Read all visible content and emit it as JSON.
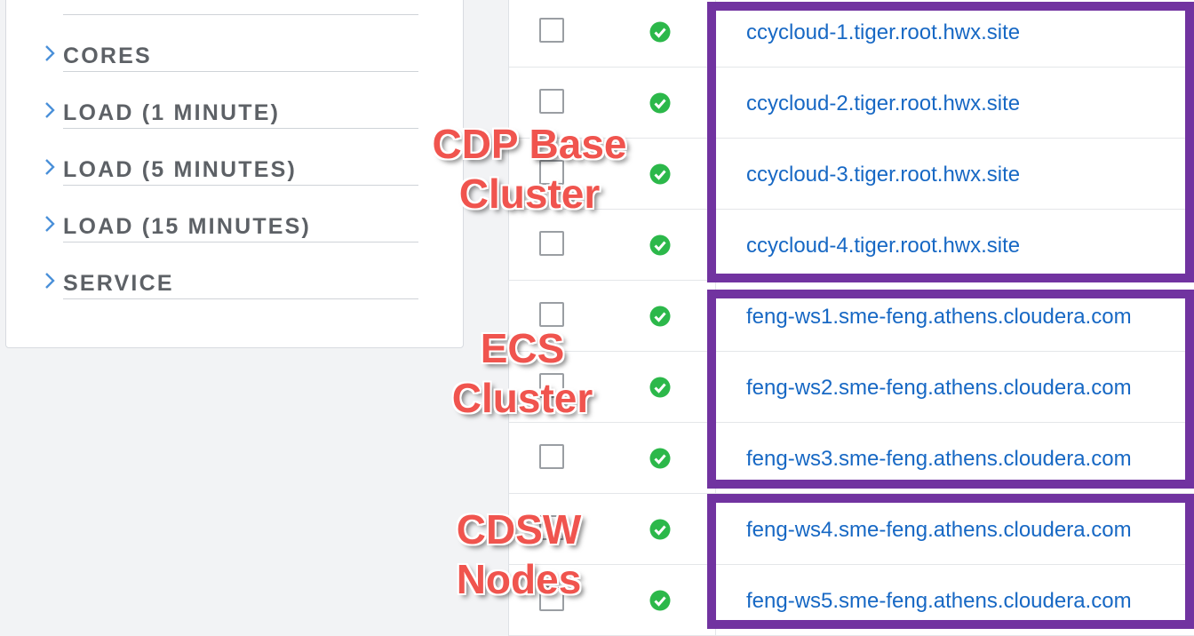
{
  "filters": [
    {
      "label": "CORES",
      "icon": "chevron-right-icon"
    },
    {
      "label": "LOAD (1 MINUTE)",
      "icon": "chevron-right-icon"
    },
    {
      "label": "LOAD (5 MINUTES)",
      "icon": "chevron-right-icon"
    },
    {
      "label": "LOAD (15 MINUTES)",
      "icon": "chevron-right-icon"
    },
    {
      "label": "SERVICE",
      "icon": "chevron-right-icon"
    }
  ],
  "hosts": [
    {
      "name": "ccycloud-1.tiger.root.hwx.site",
      "status": "good",
      "checked": false
    },
    {
      "name": "ccycloud-2.tiger.root.hwx.site",
      "status": "good",
      "checked": false
    },
    {
      "name": "ccycloud-3.tiger.root.hwx.site",
      "status": "good",
      "checked": false
    },
    {
      "name": "ccycloud-4.tiger.root.hwx.site",
      "status": "good",
      "checked": false
    },
    {
      "name": "feng-ws1.sme-feng.athens.cloudera.com",
      "status": "good",
      "checked": false
    },
    {
      "name": "feng-ws2.sme-feng.athens.cloudera.com",
      "status": "good",
      "checked": false
    },
    {
      "name": "feng-ws3.sme-feng.athens.cloudera.com",
      "status": "good",
      "checked": false
    },
    {
      "name": "feng-ws4.sme-feng.athens.cloudera.com",
      "status": "good",
      "checked": false
    },
    {
      "name": "feng-ws5.sme-feng.athens.cloudera.com",
      "status": "good",
      "checked": false
    }
  ],
  "annotations": {
    "cdp_base": {
      "line1": "CDP Base",
      "line2": "Cluster"
    },
    "ecs": {
      "line1": "ECS",
      "line2": "Cluster"
    },
    "cdsw": {
      "line1": "CDSW",
      "line2": "Nodes"
    }
  },
  "colors": {
    "link": "#1768c4",
    "status_good": "#2cb84a",
    "annotation_box": "#7133a0",
    "annotation_text": "#f0544e"
  }
}
